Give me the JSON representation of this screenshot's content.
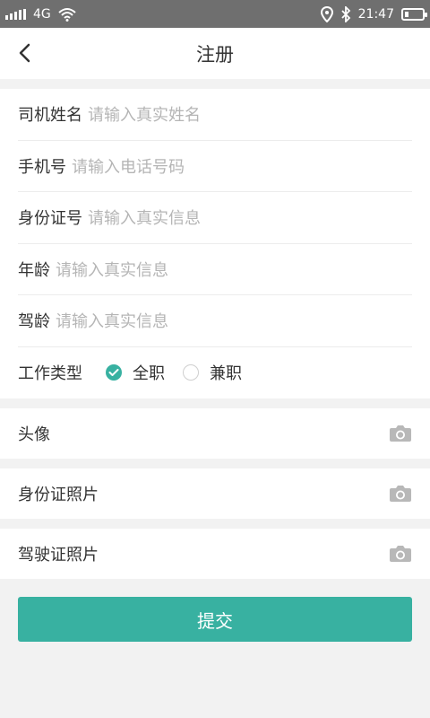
{
  "status_bar": {
    "network": "4G",
    "time": "21:47"
  },
  "header": {
    "title": "注册"
  },
  "form": {
    "fields": [
      {
        "label": "司机姓名",
        "placeholder": "请输入真实姓名"
      },
      {
        "label": "手机号",
        "placeholder": "请输入电话号码"
      },
      {
        "label": "身份证号",
        "placeholder": "请输入真实信息"
      },
      {
        "label": "年龄",
        "placeholder": "请输入真实信息"
      },
      {
        "label": "驾龄",
        "placeholder": "请输入真实信息"
      }
    ],
    "work_type": {
      "label": "工作类型",
      "options": [
        {
          "label": "全职",
          "selected": true
        },
        {
          "label": "兼职",
          "selected": false
        }
      ]
    }
  },
  "photos": {
    "avatar": "头像",
    "id_card": "身份证照片",
    "license": "驾驶证照片"
  },
  "submit": {
    "label": "提交"
  },
  "colors": {
    "accent": "#38b1a1",
    "placeholder": "#b5b5b5",
    "status_bar": "#6f6f6f"
  },
  "icons": [
    "signal-icon",
    "wifi-icon",
    "location-icon",
    "bluetooth-icon",
    "battery-icon",
    "back-chevron-icon",
    "check-icon",
    "camera-icon"
  ]
}
